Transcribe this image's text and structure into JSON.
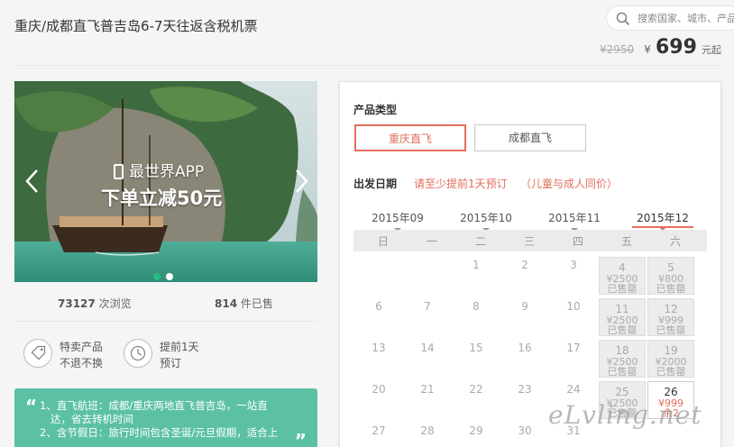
{
  "header": {
    "title": "重庆/成都直飞普吉岛6-7天往返含税机票",
    "search_placeholder": "搜索国家、城市、产品",
    "original_price": "¥2950",
    "currency_symbol": "¥",
    "current_price": "699",
    "price_suffix": "元起"
  },
  "banner": {
    "promo_line1": "最世界APP",
    "promo_line2": "下单立减50元",
    "slides": 2,
    "active_slide": 1
  },
  "stats": {
    "views_count": "73127",
    "views_label": "次浏览",
    "sold_count": "814",
    "sold_label": "件已售"
  },
  "features": [
    {
      "line1": "特卖产品",
      "line2": "不退不换",
      "icon": "tag-icon"
    },
    {
      "line1": "提前1天",
      "line2": "预订",
      "icon": "clock-icon"
    }
  ],
  "info": {
    "line1": "1、直飞航班：成都/重庆两地直飞普吉岛，一站直",
    "line2": "达，省去转机时间",
    "line3": "2、含节假日：旅行时间包含圣诞/元旦假期，适合上"
  },
  "booking": {
    "type_title": "产品类型",
    "types": [
      "重庆直飞",
      "成都直飞"
    ],
    "active_type": 0,
    "date_title": "出发日期",
    "note1": "请至少提前1天预订",
    "note2": "（儿童与成人同价）",
    "months": [
      "2015年09",
      "2015年10",
      "2015年11",
      "2015年12"
    ],
    "active_month": 3,
    "weekdays": [
      "日",
      "一",
      "二",
      "三",
      "四",
      "五",
      "六"
    ]
  },
  "calendar": [
    {
      "day": "1",
      "col": 2,
      "row": 0
    },
    {
      "day": "2",
      "col": 3,
      "row": 0
    },
    {
      "day": "3",
      "col": 4,
      "row": 0
    },
    {
      "day": "4",
      "col": 5,
      "row": 0,
      "price": "¥2500",
      "status": "已售罄"
    },
    {
      "day": "5",
      "col": 6,
      "row": 0,
      "price": "¥800",
      "status": "已售罄"
    },
    {
      "day": "6",
      "col": 0,
      "row": 1
    },
    {
      "day": "7",
      "col": 1,
      "row": 1
    },
    {
      "day": "8",
      "col": 2,
      "row": 1
    },
    {
      "day": "9",
      "col": 3,
      "row": 1
    },
    {
      "day": "10",
      "col": 4,
      "row": 1
    },
    {
      "day": "11",
      "col": 5,
      "row": 1,
      "price": "¥2500",
      "status": "已售罄"
    },
    {
      "day": "12",
      "col": 6,
      "row": 1,
      "price": "¥999",
      "status": "已售罄"
    },
    {
      "day": "13",
      "col": 0,
      "row": 2
    },
    {
      "day": "14",
      "col": 1,
      "row": 2
    },
    {
      "day": "15",
      "col": 2,
      "row": 2
    },
    {
      "day": "16",
      "col": 3,
      "row": 2
    },
    {
      "day": "17",
      "col": 4,
      "row": 2
    },
    {
      "day": "18",
      "col": 5,
      "row": 2,
      "price": "¥2500",
      "status": "已售罄"
    },
    {
      "day": "19",
      "col": 6,
      "row": 2,
      "price": "¥2000",
      "status": "已售罄"
    },
    {
      "day": "20",
      "col": 0,
      "row": 3
    },
    {
      "day": "21",
      "col": 1,
      "row": 3
    },
    {
      "day": "22",
      "col": 2,
      "row": 3
    },
    {
      "day": "23",
      "col": 3,
      "row": 3
    },
    {
      "day": "24",
      "col": 4,
      "row": 3
    },
    {
      "day": "25",
      "col": 5,
      "row": 3,
      "price": "¥2500",
      "status": "已售罄"
    },
    {
      "day": "26",
      "col": 6,
      "row": 3,
      "price": "¥999",
      "status": "余2",
      "live": true
    },
    {
      "day": "27",
      "col": 0,
      "row": 4
    },
    {
      "day": "28",
      "col": 1,
      "row": 4
    },
    {
      "day": "29",
      "col": 2,
      "row": 4
    },
    {
      "day": "30",
      "col": 3,
      "row": 4
    },
    {
      "day": "31",
      "col": 4,
      "row": 4
    }
  ],
  "watermark": "eLvling.net",
  "colors": {
    "accent": "#e36f5c",
    "info_bg": "#5cc1a4",
    "dot_active": "#2eb88a"
  }
}
